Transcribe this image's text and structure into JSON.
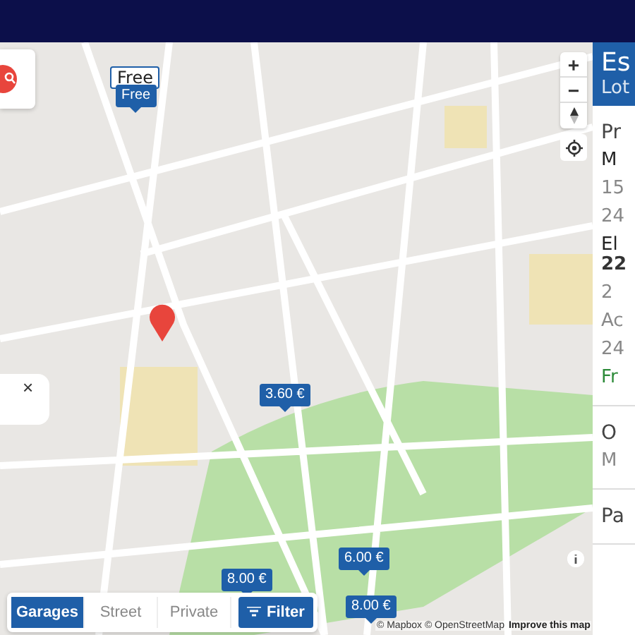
{
  "map": {
    "tooltip": "Free",
    "pins": [
      {
        "label": "Free"
      },
      {
        "label": "3.60 €"
      },
      {
        "label": "6.00 €"
      },
      {
        "label": "8.00 €"
      },
      {
        "label": "8.00 €"
      }
    ],
    "popup": {
      "close": "×"
    },
    "zoom_in": "+",
    "zoom_out": "−",
    "segments": [
      {
        "label": "Garages",
        "selected": true
      },
      {
        "label": "Street",
        "selected": false
      },
      {
        "label": "Private",
        "selected": false
      }
    ],
    "filter": "Filter",
    "attribution": {
      "text": "© Mapbox © OpenStreetMap",
      "link": "Improve this map"
    }
  },
  "panel": {
    "title": "Es",
    "subtitle": "Lot",
    "sections": [
      {
        "lines": [
          {
            "text": "Pr",
            "kind": "heading"
          },
          {
            "text": "M",
            "kind": "label"
          },
          {
            "text": "15",
            "kind": "detail"
          },
          {
            "text": "24",
            "kind": "detail"
          },
          {
            "text": "El",
            "kind": "label"
          },
          {
            "text": "22",
            "kind": "bold"
          },
          {
            "text": "2",
            "kind": "detail"
          },
          {
            "text": "Ac",
            "kind": "detail"
          },
          {
            "text": "24",
            "kind": "detail"
          },
          {
            "text": "Fr",
            "kind": "status"
          }
        ]
      },
      {
        "lines": [
          {
            "text": "O",
            "kind": "heading"
          },
          {
            "text": "M",
            "kind": "detail"
          }
        ]
      },
      {
        "lines": [
          {
            "text": "Pa",
            "kind": "heading"
          }
        ]
      }
    ]
  }
}
